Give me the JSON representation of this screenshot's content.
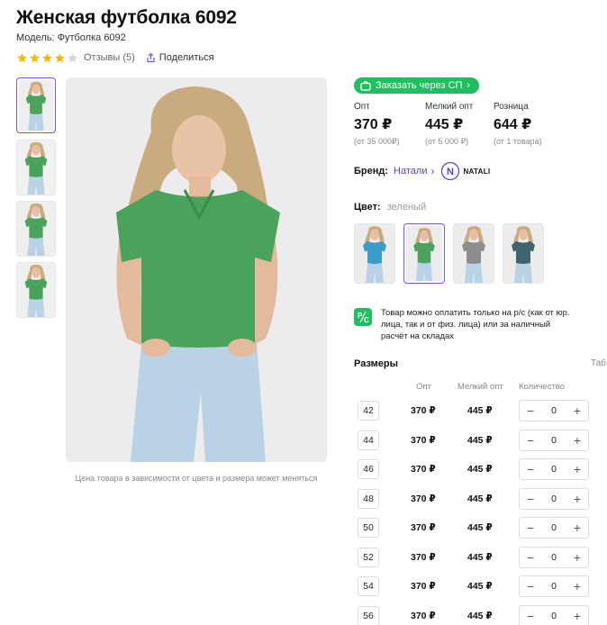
{
  "product": {
    "title": "Женская футболка 6092",
    "model": "Модель: Футболка 6092",
    "rating_stars": 4,
    "reviews": "Отзывы (5)",
    "share": "Поделиться"
  },
  "gallery": {
    "note": "Цена товара в зависимости от цвета и размера может меняться"
  },
  "order_button": "Заказать через СП",
  "prices": [
    {
      "label": "Опт",
      "value": "370 ₽",
      "sub": "(от 35 000₽)"
    },
    {
      "label": "Мелкий опт",
      "value": "445 ₽",
      "sub": "(от 5 000 ₽)"
    },
    {
      "label": "Розница",
      "value": "644 ₽",
      "sub": "(от 1 товара)"
    }
  ],
  "brand": {
    "label": "Бренд:",
    "name": "Натали",
    "logo_text": "NATALI",
    "logo_letter": "N"
  },
  "color": {
    "label": "Цвет:",
    "value": "зеленый",
    "swatches": [
      {
        "color": "#3b9cc9"
      },
      {
        "color": "#4aa35a"
      },
      {
        "color": "#8d8d8d"
      },
      {
        "color": "#3e6470"
      }
    ]
  },
  "payment": {
    "icon_letter": "P/C",
    "text": "Товар можно оплатить только на р/с (как от юр. лица, так и от физ. лица) или за наличный расчёт на складах"
  },
  "sizes": {
    "title": "Размеры",
    "table_link": "Таб",
    "headers": {
      "opt": "Опт",
      "small": "Мелкий опт",
      "qty": "Количество"
    },
    "rows": [
      {
        "size": "42",
        "opt": "370 ₽",
        "small": "445 ₽",
        "qty": "0"
      },
      {
        "size": "44",
        "opt": "370 ₽",
        "small": "445 ₽",
        "qty": "0"
      },
      {
        "size": "46",
        "opt": "370 ₽",
        "small": "445 ₽",
        "qty": "0"
      },
      {
        "size": "48",
        "opt": "370 ₽",
        "small": "445 ₽",
        "qty": "0"
      },
      {
        "size": "50",
        "opt": "370 ₽",
        "small": "445 ₽",
        "qty": "0"
      },
      {
        "size": "52",
        "opt": "370 ₽",
        "small": "445 ₽",
        "qty": "0"
      },
      {
        "size": "54",
        "opt": "370 ₽",
        "small": "445 ₽",
        "qty": "0"
      },
      {
        "size": "56",
        "opt": "370 ₽",
        "small": "445 ₽",
        "qty": "0"
      }
    ]
  },
  "colors": {
    "accent": "#6c5ce7",
    "brand_link": "#5a3fd1",
    "green": "#1fbf5f",
    "star": "#f6b800",
    "shirt": "#4aa35a"
  }
}
